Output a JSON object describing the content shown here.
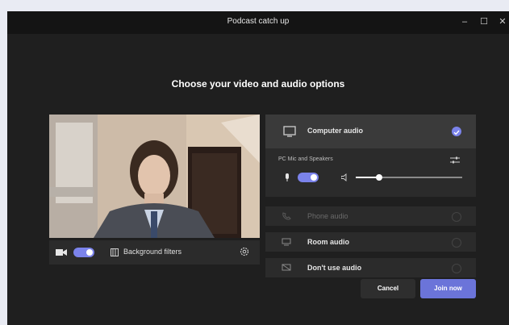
{
  "window": {
    "title": "Podcast catch up",
    "controls": {
      "minimize": "–",
      "maximize": "☐",
      "close": "✕"
    }
  },
  "heading": "Choose your video and audio options",
  "video_bar": {
    "camera_toggle_on": true,
    "background_filters_label": "Background filters"
  },
  "audio": {
    "computer_audio": {
      "label": "Computer audio",
      "selected": true
    },
    "device_label": "PC Mic and Speakers",
    "mic_toggle_on": true,
    "volume_level": 0.22,
    "options": [
      {
        "label": "Phone audio",
        "disabled": true
      },
      {
        "label": "Room audio",
        "disabled": false
      },
      {
        "label": "Don't use audio",
        "disabled": false
      }
    ]
  },
  "buttons": {
    "cancel": "Cancel",
    "join": "Join now"
  },
  "colors": {
    "accent": "#7b83eb",
    "background": "#1f1f1f",
    "panel": "#2b2b2b"
  }
}
